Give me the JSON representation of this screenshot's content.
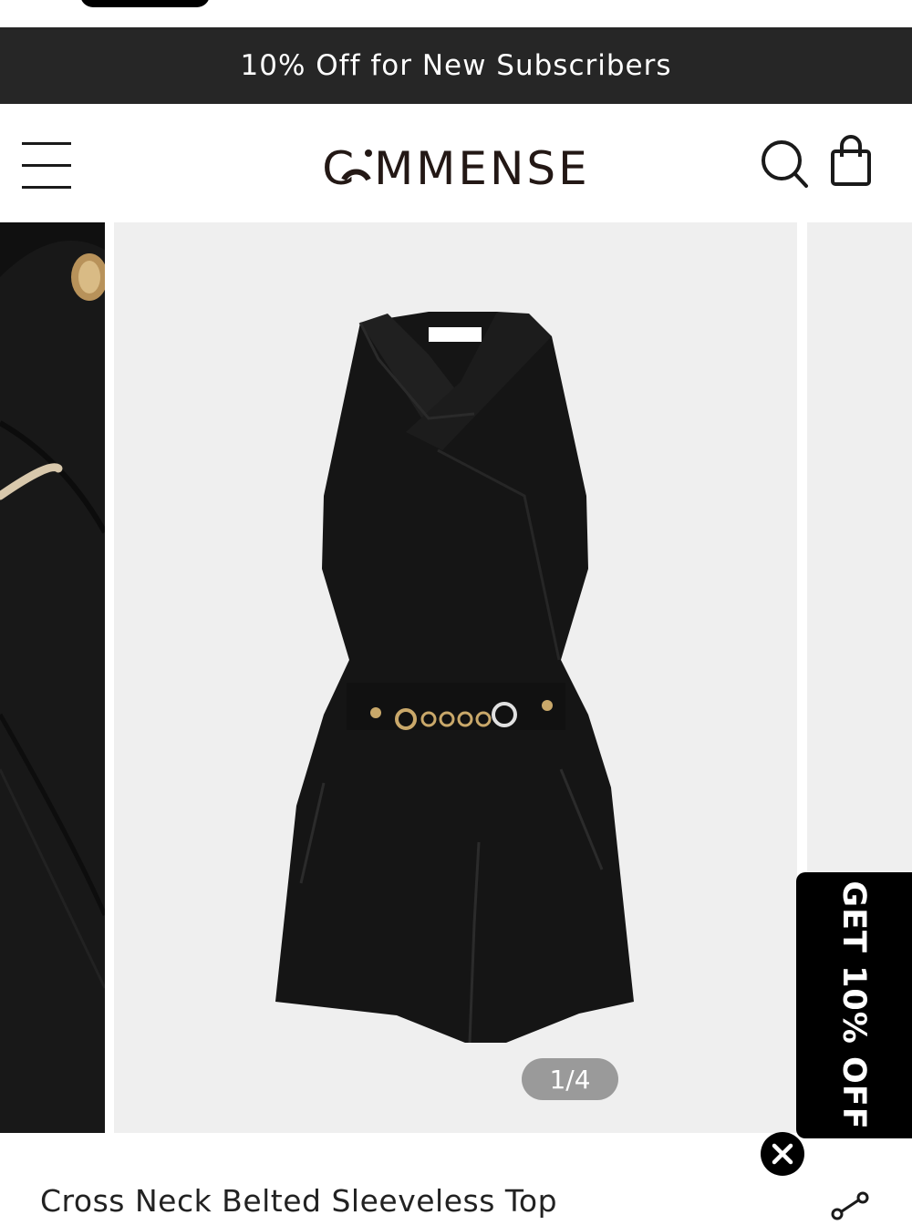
{
  "promo_banner": {
    "text": "10% Off for New Subscribers"
  },
  "header": {
    "logo_text": "COMMENSE",
    "menu_icon": "hamburger-icon",
    "search_icon": "search-icon",
    "bag_icon": "shopping-bag-icon"
  },
  "gallery": {
    "counter": "1/4",
    "current": 1,
    "total": 4
  },
  "side_promo": {
    "text": "GET 10% OFF",
    "close_icon": "close-icon"
  },
  "product": {
    "title": "Cross Neck Belted Sleeveless Top",
    "share_icon": "share-icon"
  },
  "colors": {
    "promo_bg": "#262626",
    "image_bg": "#efefef",
    "counter_bg": "#9a9a9a",
    "garment": "#151515",
    "hardware_gold": "#c9a86a"
  }
}
